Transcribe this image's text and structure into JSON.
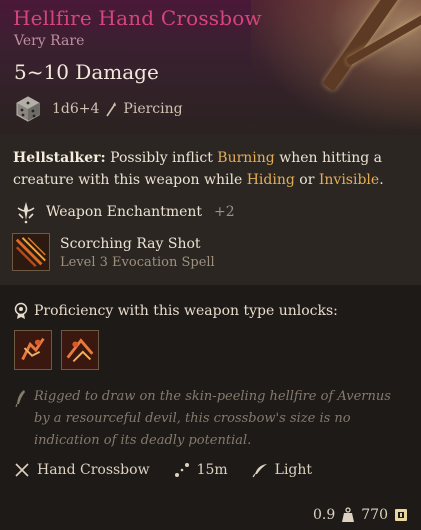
{
  "item": {
    "name": "Hellfire Hand Crossbow",
    "rarity": "Very Rare",
    "damage_range": "5~10 Damage",
    "damage_dice": "1d6+4",
    "damage_type": "Piercing"
  },
  "effect": {
    "name": "Hellstalker:",
    "text_1": " Possibly inflict ",
    "keyword_1": "Burning",
    "text_2": " when hitting a creature with this weapon while ",
    "keyword_2": "Hiding",
    "text_3": " or ",
    "keyword_3": "Invisible",
    "text_4": "."
  },
  "enchantment": {
    "label": "Weapon Enchantment",
    "bonus": "+2"
  },
  "spell": {
    "name": "Scorching Ray Shot",
    "subtitle": "Level 3 Evocation Spell"
  },
  "proficiency": {
    "label": "Proficiency with this weapon type unlocks:"
  },
  "lore": "Rigged to draw on the skin-peeling hellfire of Avernus by a resourceful devil, this crossbow's size is no indication of its deadly potential.",
  "properties": {
    "weapon_type": "Hand Crossbow",
    "range": "15m",
    "weight_class": "Light"
  },
  "footer": {
    "weight": "0.9",
    "value": "770"
  },
  "colors": {
    "title": "#d6447e",
    "keyword": "#e3ae58",
    "rarity": "#c08fa0"
  }
}
